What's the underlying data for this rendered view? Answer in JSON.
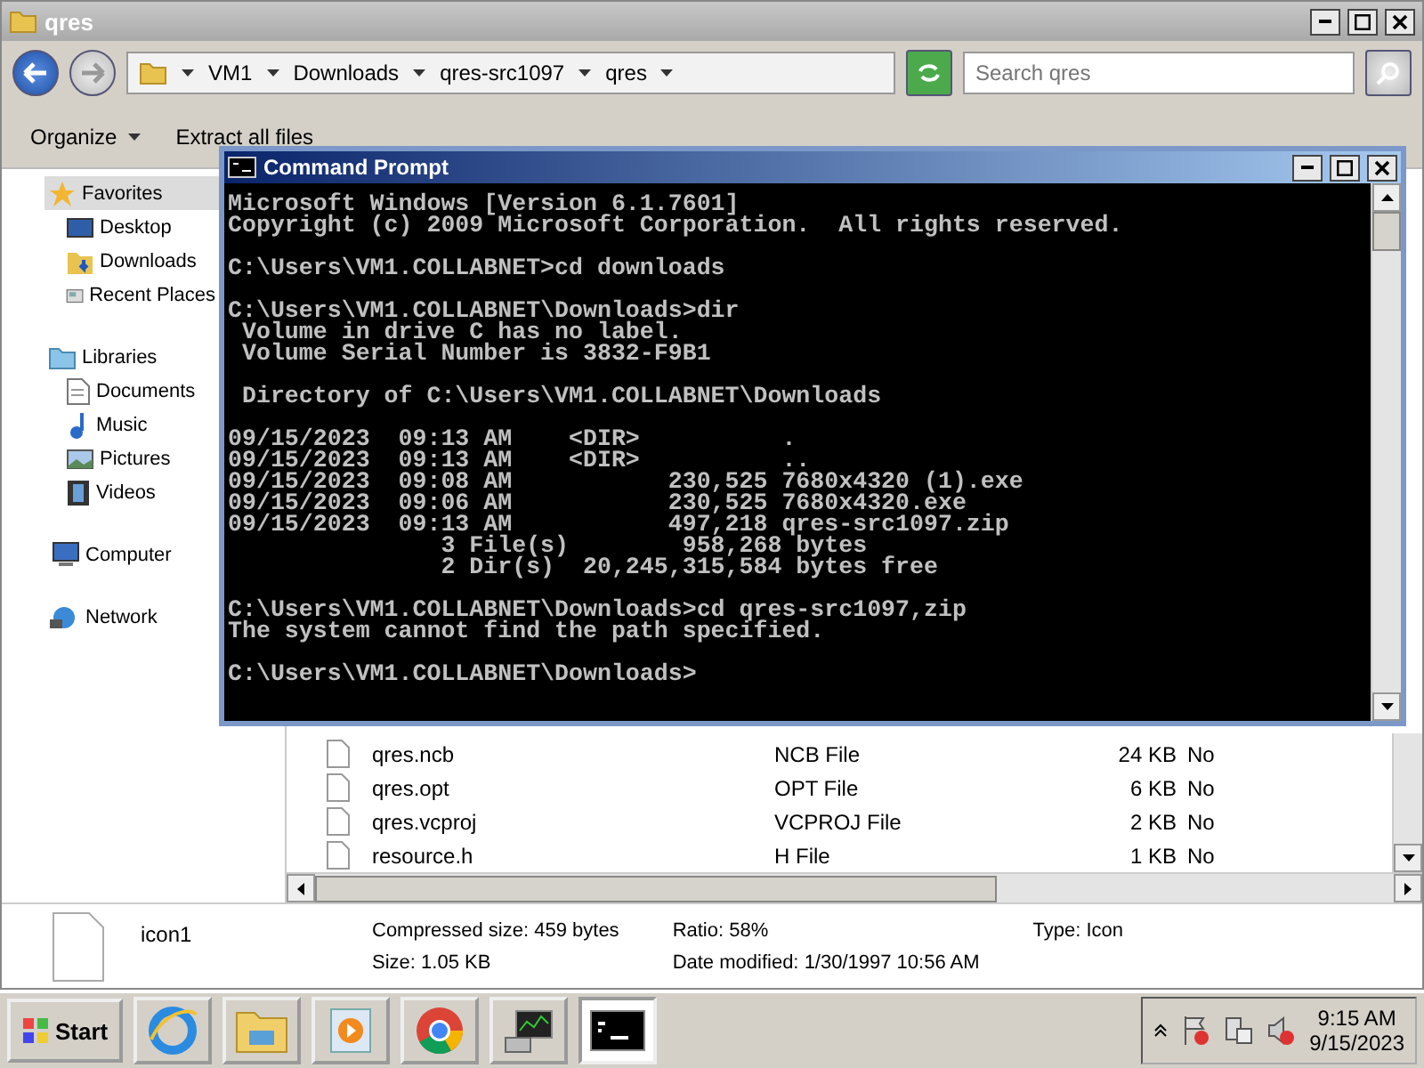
{
  "explorer": {
    "title": "qres",
    "breadcrumb": [
      "VM1",
      "Downloads",
      "qres-src1097",
      "qres"
    ],
    "search": {
      "placeholder": "Search qres"
    },
    "toolbar": [
      {
        "label": "Organize",
        "dropdown": true
      },
      {
        "label": "Extract all files",
        "dropdown": false
      }
    ],
    "sidebar": [
      {
        "label": "Favorites",
        "selected": true,
        "children": [
          {
            "label": "Desktop",
            "selected": false
          },
          {
            "label": "Downloads",
            "selected": false
          },
          {
            "label": "Recent Places",
            "selected": false
          }
        ]
      },
      {
        "label": "Libraries",
        "selected": false,
        "children": [
          {
            "label": "Documents",
            "selected": false
          },
          {
            "label": "Music",
            "selected": false
          },
          {
            "label": "Pictures",
            "selected": false
          },
          {
            "label": "Videos",
            "selected": false
          }
        ]
      },
      {
        "label": "Computer",
        "selected": false
      },
      {
        "label": "Network",
        "selected": false
      }
    ],
    "files": [
      {
        "name": "qres.ncb",
        "type": "NCB File",
        "size": "24 KB",
        "column_4": "No"
      },
      {
        "name": "qres.opt",
        "type": "OPT File",
        "size": "6 KB",
        "column_4": "No"
      },
      {
        "name": "qres.vcproj",
        "type": "VCPROJ File",
        "size": "2 KB",
        "column_4": "No"
      },
      {
        "name": "resource.h",
        "type": "H File",
        "size": "1 KB",
        "column_4": "No"
      }
    ],
    "details": {
      "name": "icon1",
      "fields": [
        {
          "label": "Compressed size:",
          "value": "459 bytes"
        },
        {
          "label": "Ratio:",
          "value": "58%"
        },
        {
          "label": "Type:",
          "value": "Icon"
        },
        {
          "label": "Size:",
          "value": "1.05 KB"
        },
        {
          "label": "Date modified:",
          "value": "1/30/1997 10:56 AM"
        }
      ]
    }
  },
  "console": {
    "title": "Command Prompt",
    "blocks": [
      [
        "Microsoft Windows [Version 6.1.7601]",
        "Copyright (c) 2009 Microsoft Corporation.  All rights reserved."
      ],
      [
        "C:\\Users\\VM1.COLLABNET>cd downloads"
      ],
      [
        "C:\\Users\\VM1.COLLABNET\\Downloads>dir",
        " Volume in drive C has no label.",
        " Volume Serial Number is 3832-F9B1"
      ],
      [
        " Directory of C:\\Users\\VM1.COLLABNET\\Downloads"
      ],
      [
        "09/15/2023  09:13 AM    <DIR>          .",
        "09/15/2023  09:13 AM    <DIR>          ..",
        "09/15/2023  09:08 AM           230,525 7680x4320 (1).exe",
        "09/15/2023  09:06 AM           230,525 7680x4320.exe",
        "09/15/2023  09:13 AM           497,218 qres-src1097.zip",
        "               3 File(s)        958,268 bytes",
        "               2 Dir(s)  20,245,315,584 bytes free"
      ],
      [
        "C:\\Users\\VM1.COLLABNET\\Downloads>cd qres-src1097,zip",
        "The system cannot find the path specified."
      ],
      [
        "C:\\Users\\VM1.COLLABNET\\Downloads>"
      ]
    ]
  },
  "taskbar": {
    "start": "Start",
    "apps": [
      {
        "kind": "ie",
        "selected": false
      },
      {
        "kind": "explorer",
        "selected": false
      },
      {
        "kind": "media",
        "selected": false
      },
      {
        "kind": "chrome",
        "selected": false
      },
      {
        "kind": "network",
        "selected": false
      },
      {
        "kind": "console",
        "selected": true
      }
    ],
    "time": "9:15 AM",
    "date": "9/15/2023"
  }
}
